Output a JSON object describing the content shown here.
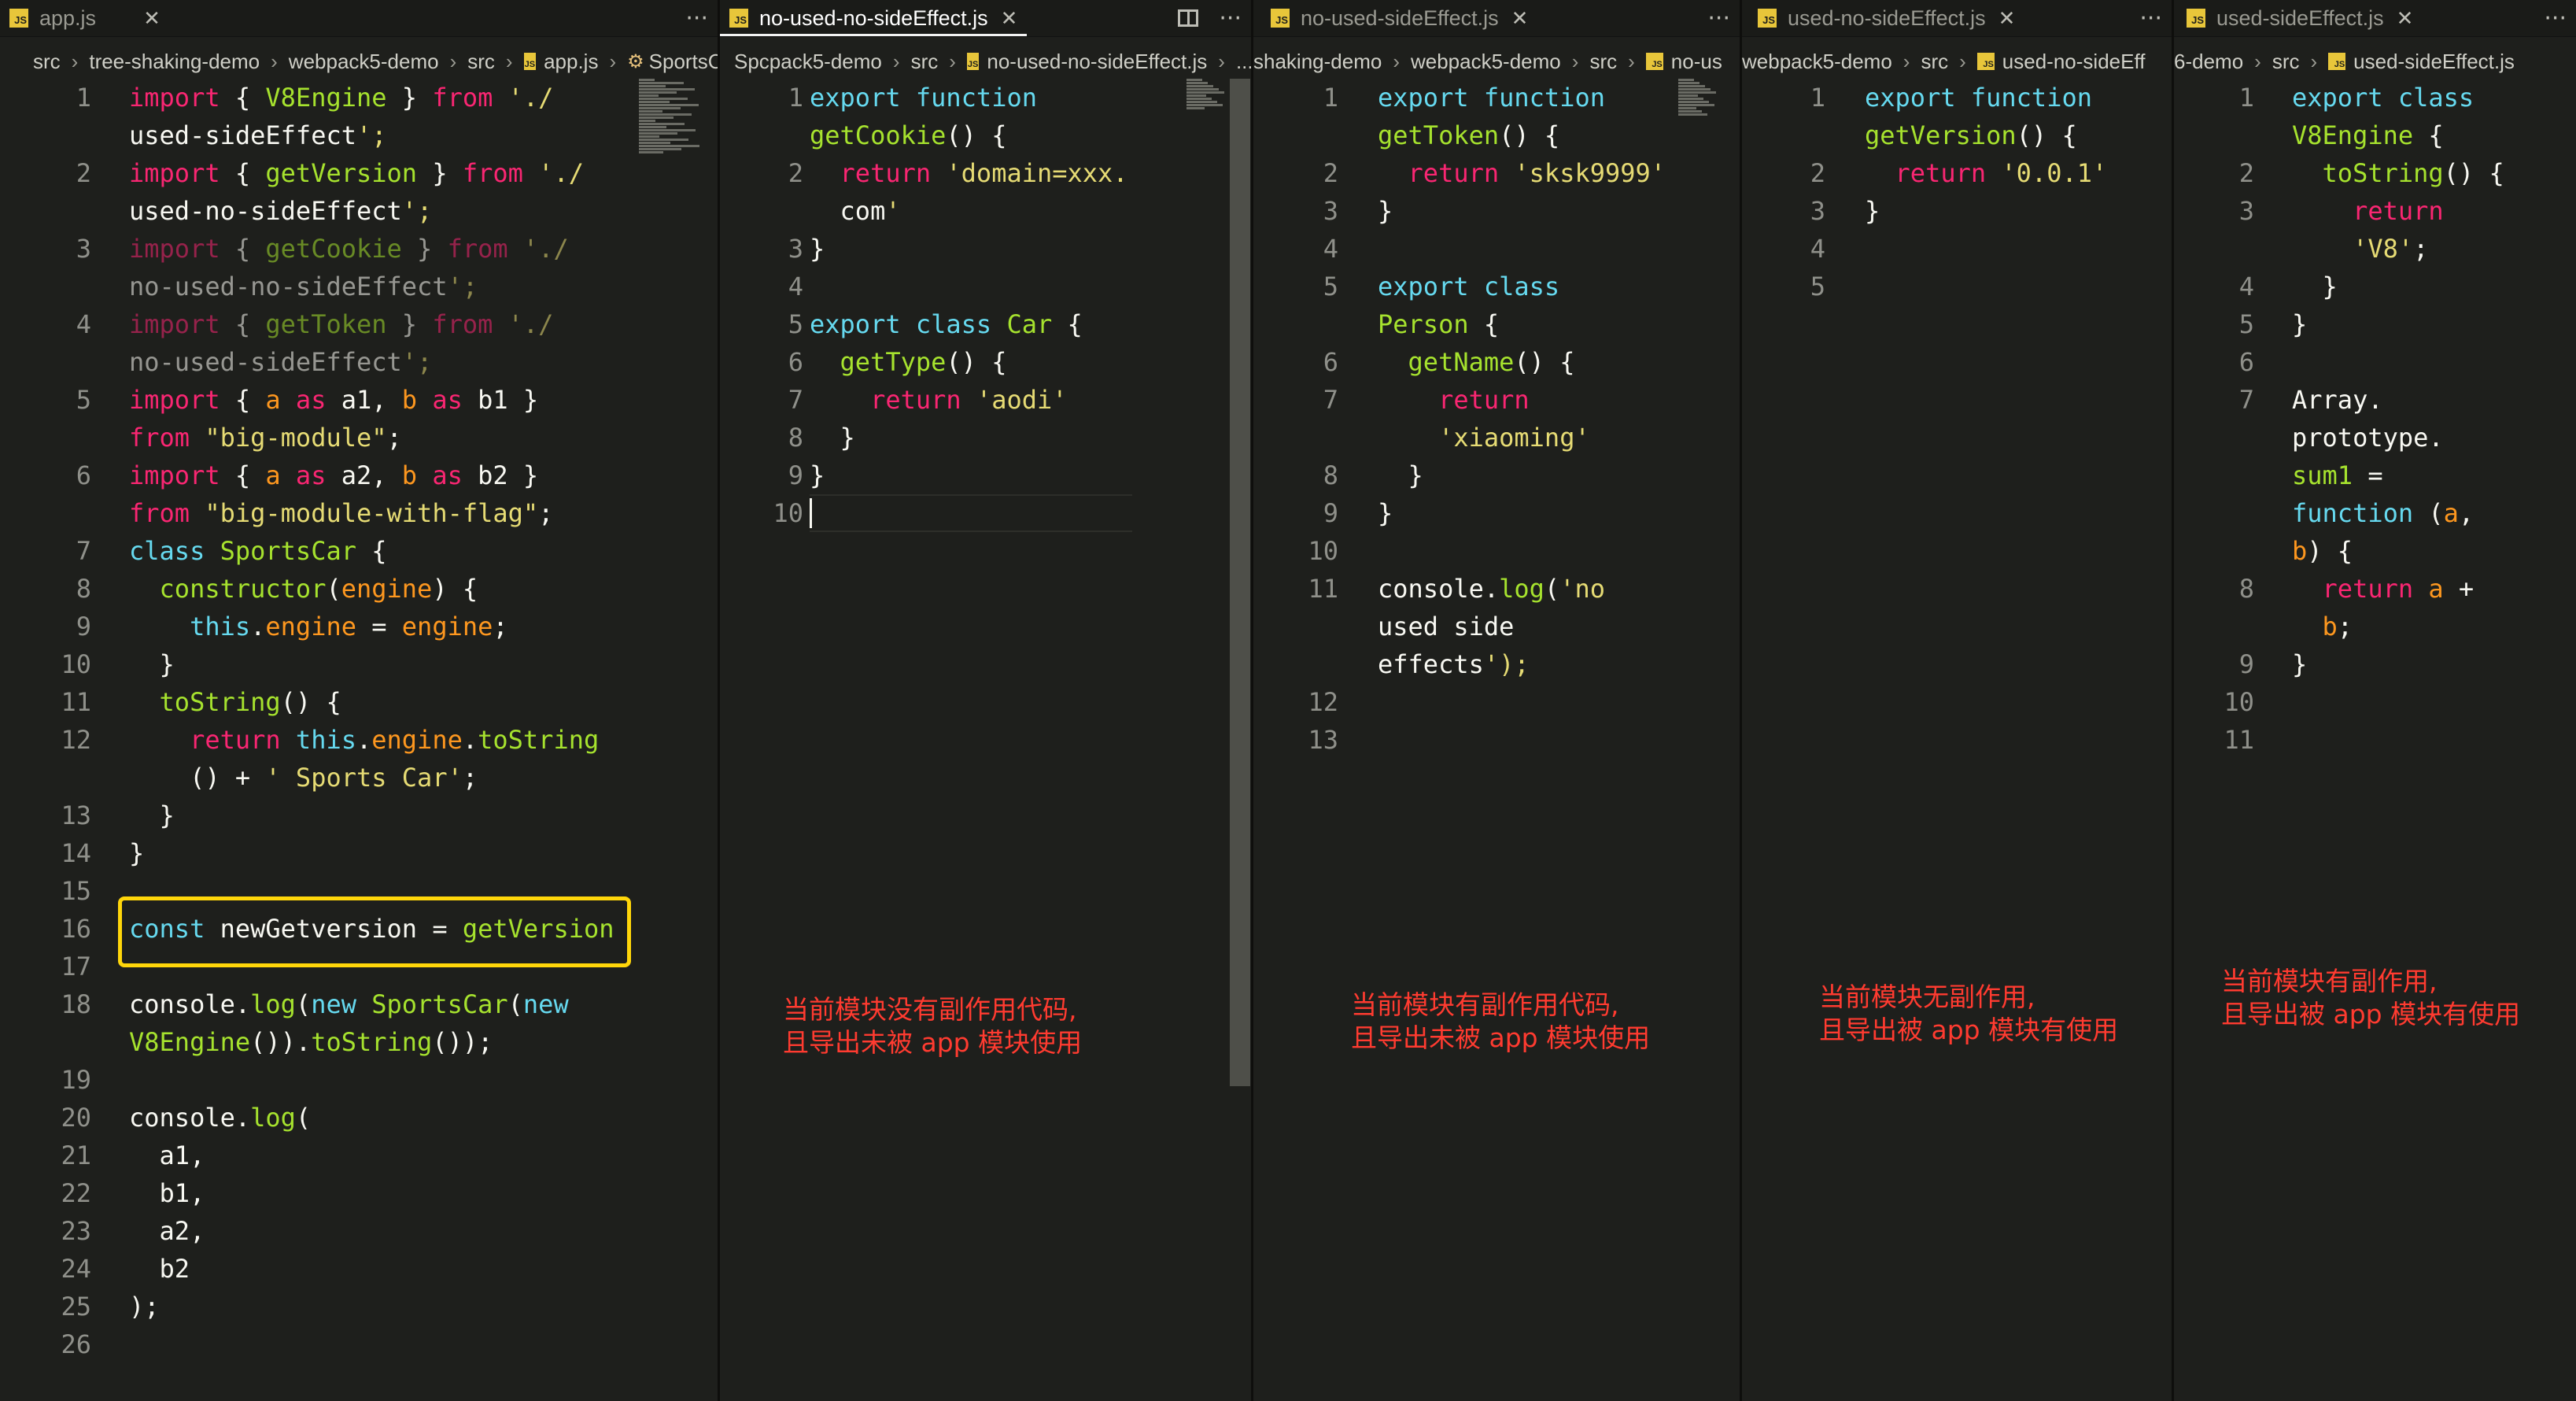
{
  "panes": [
    {
      "tab": {
        "label": "app.js",
        "active": false
      },
      "breadcrumb": [
        "src",
        "tree-shaking-demo",
        "webpack5-demo",
        "src",
        "app.js",
        "SportsCar"
      ],
      "line_numbers": [
        "1",
        "",
        "2",
        "",
        "3",
        "",
        "4",
        "",
        "5",
        "",
        "6",
        "",
        "7",
        "8",
        "9",
        "10",
        "11",
        "12",
        "",
        "13",
        "14",
        "15",
        "16",
        "17",
        "18",
        "",
        "19",
        "20",
        "21",
        "22",
        "23",
        "24",
        "25",
        "26"
      ],
      "code_lines": [
        "import { V8Engine } from './",
        "used-sideEffect';",
        "import { getVersion } from './",
        "used-no-sideEffect';",
        "import { getCookie } from './",
        "no-used-no-sideEffect';",
        "import { getToken } from './",
        "no-used-sideEffect';",
        "import { a as a1, b as b1 }",
        "from \"big-module\";",
        "import { a as a2, b as b2 }",
        "from \"big-module-with-flag\";",
        "class SportsCar {",
        "  constructor(engine) {",
        "    this.engine = engine;",
        "  }",
        "  toString() {",
        "    return this.engine.toString",
        "    () + ' Sports Car';",
        "  }",
        "}",
        "",
        "const newGetversion = getVersion",
        "",
        "console.log(new SportsCar(new",
        "V8Engine()).toString());",
        "",
        "console.log(",
        "  a1,",
        "  b1,",
        "  a2,",
        "  b2",
        ");",
        ""
      ],
      "annotation": ""
    },
    {
      "tab": {
        "label": "no-used-no-sideEffect.js",
        "active": true
      },
      "breadcrumb": [
        "Spcpack5-demo",
        "src",
        "no-used-no-sideEffect.js",
        "..."
      ],
      "line_numbers": [
        "1",
        "",
        "2",
        "",
        "3",
        "4",
        "5",
        "6",
        "7",
        "8",
        "9",
        "10"
      ],
      "code_lines": [
        "export function",
        "getCookie() {",
        "  return 'domain=xxx.",
        "  com'",
        "}",
        "",
        "export class Car {",
        "  getType() {",
        "    return 'aodi'",
        "  }",
        "}",
        ""
      ],
      "annotation": "当前模块没有副作用代码,\n且导出未被 app 模块使用"
    },
    {
      "tab": {
        "label": "no-used-sideEffect.js",
        "active": false
      },
      "breadcrumb": [
        "shaking-demo",
        "webpack5-demo",
        "src",
        "no-us"
      ],
      "line_numbers": [
        "1",
        "",
        "2",
        "3",
        "4",
        "5",
        "",
        "6",
        "7",
        "",
        "8",
        "9",
        "10",
        "11",
        "",
        "",
        "12",
        "13"
      ],
      "code_lines": [
        "export function",
        "getToken() {",
        "  return 'sksk9999'",
        "}",
        "",
        "export class",
        "Person {",
        "  getName() {",
        "    return",
        "    'xiaoming'",
        "  }",
        "}",
        "",
        "console.log('no",
        "used side",
        "effects');",
        "",
        ""
      ],
      "annotation": "当前模块有副作用代码,\n且导出未被 app 模块使用"
    },
    {
      "tab": {
        "label": "used-no-sideEffect.js",
        "active": false
      },
      "breadcrumb": [
        "webpack5-demo",
        "src",
        "used-no-sideEff"
      ],
      "line_numbers": [
        "1",
        "",
        "2",
        "3",
        "4",
        "5"
      ],
      "code_lines": [
        "export function",
        "getVersion() {",
        "  return '0.0.1'",
        "}",
        "",
        ""
      ],
      "annotation": "当前模块无副作用,\n且导出被 app 模块有使用"
    },
    {
      "tab": {
        "label": "used-sideEffect.js",
        "active": false
      },
      "breadcrumb": [
        "6-demo",
        "src",
        "used-sideEffect.js"
      ],
      "line_numbers": [
        "1",
        "",
        "2",
        "3",
        "",
        "4",
        "5",
        "6",
        "7",
        "",
        "",
        "",
        "",
        "8",
        "",
        "9",
        "10",
        "11"
      ],
      "code_lines": [
        "export class",
        "V8Engine {",
        "  toString() {",
        "    return",
        "    'V8';",
        "  }",
        "}",
        "",
        "Array.",
        "prototype.",
        "sum1 =",
        "function (a,",
        "b) {",
        "  return a +",
        "  b;",
        "}",
        "",
        ""
      ],
      "annotation": "当前模块有副作用,\n且导出被 app 模块有使用"
    }
  ],
  "colors": {
    "background": "#1e1f1c",
    "keyword": "#66d9ef",
    "import_keyword": "#f92672",
    "string": "#e6db74",
    "function": "#a6e22e",
    "param": "#fd971f",
    "annotation": "#ff3b30",
    "highlight_box": "#ffd60a"
  },
  "icons": {
    "file": "js-file-icon",
    "close": "close-icon",
    "more": "more-actions-icon",
    "split": "split-editor-icon",
    "symbol": "class-symbol-icon"
  }
}
